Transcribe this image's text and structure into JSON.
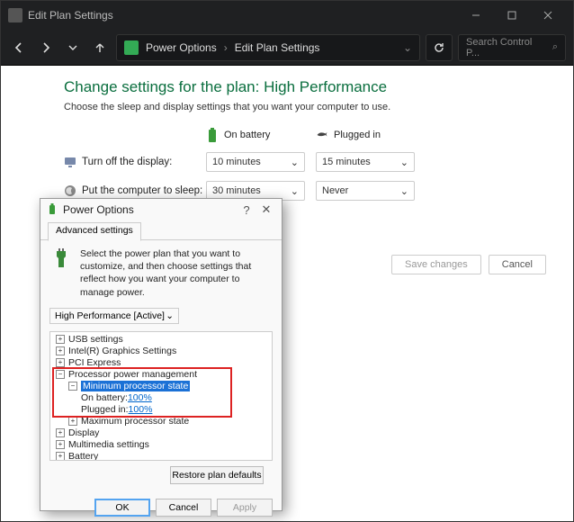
{
  "titlebar": {
    "title": "Edit Plan Settings"
  },
  "nav": {
    "crumb1": "Power Options",
    "crumb2": "Edit Plan Settings",
    "search_placeholder": "Search Control P..."
  },
  "page": {
    "heading": "Change settings for the plan: High Performance",
    "sub": "Choose the sleep and display settings that you want your computer to use.",
    "col_battery": "On battery",
    "col_plugged": "Plugged in",
    "row_display": "Turn off the display:",
    "row_sleep": "Put the computer to sleep:",
    "display_batt": "10 minutes",
    "display_plug": "15 minutes",
    "sleep_batt": "30 minutes",
    "sleep_plug": "Never",
    "save": "Save changes",
    "cancel": "Cancel"
  },
  "dialog": {
    "title": "Power Options",
    "tab": "Advanced settings",
    "desc": "Select the power plan that you want to customize, and then choose settings that reflect how you want your computer to manage power.",
    "plan": "High Performance [Active]",
    "tree": {
      "usb": "USB settings",
      "intel": "Intel(R) Graphics Settings",
      "pci": "PCI Express",
      "proc": "Processor power management",
      "minstate": "Minimum processor state",
      "onbatt_lbl": "On battery: ",
      "onbatt_val": "100%",
      "plugged_lbl": "Plugged in: ",
      "plugged_val": "100%",
      "maxstate": "Maximum processor state",
      "display": "Display",
      "multimedia": "Multimedia settings",
      "battery": "Battery"
    },
    "restore": "Restore plan defaults",
    "ok": "OK",
    "cancel": "Cancel",
    "apply": "Apply",
    "help": "?",
    "close": "✕"
  }
}
